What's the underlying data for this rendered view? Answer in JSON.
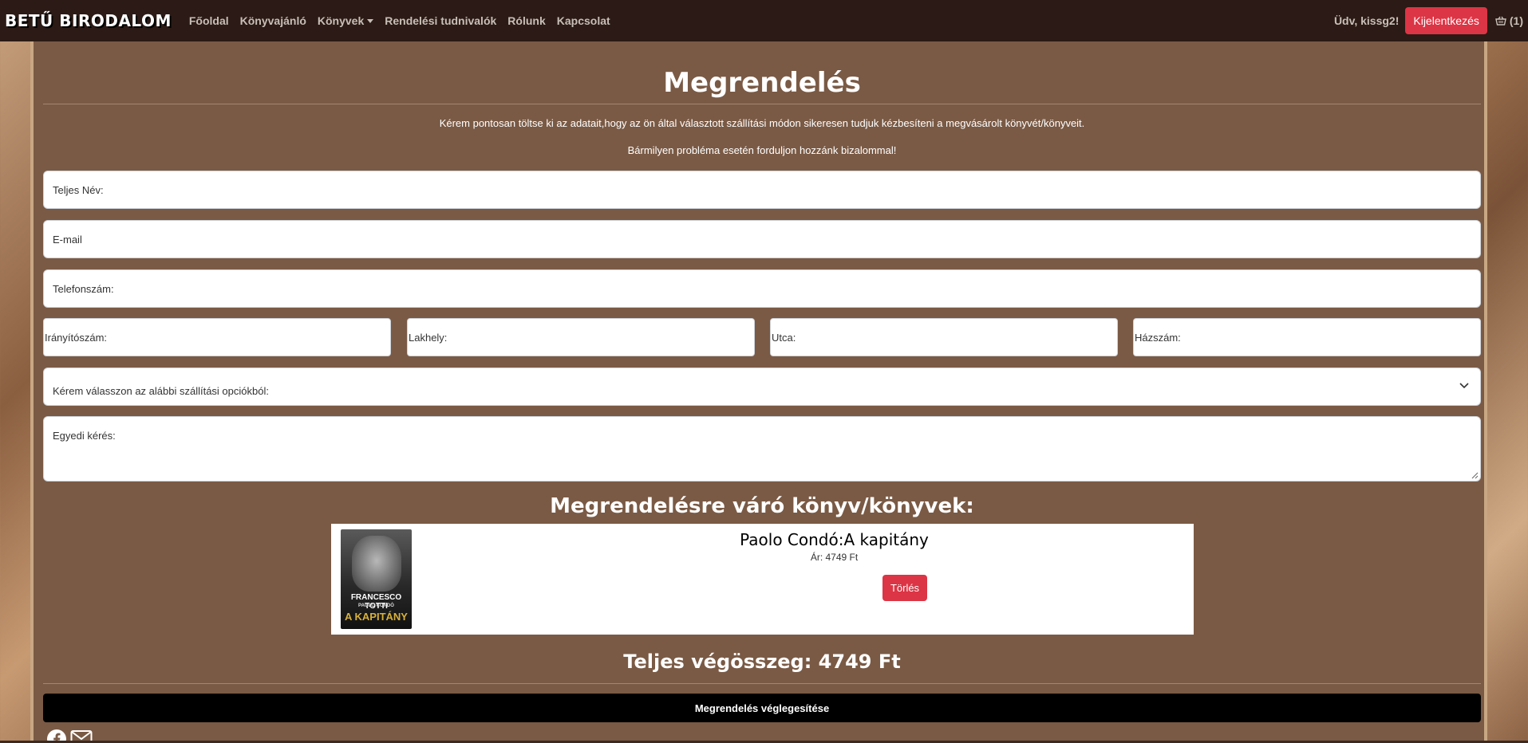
{
  "navbar": {
    "brand": "BETŰ BIRODALOM",
    "links": [
      "Főoldal",
      "Könyvajánló",
      "Könyvek",
      "Rendelési tudnivalók",
      "Rólunk",
      "Kapcsolat"
    ],
    "greeting": "Üdv, kissg2!",
    "logout_label": "Kijelentkezés",
    "cart_count": "(1)"
  },
  "page": {
    "title": "Megrendelés",
    "intro_line1": "Kérem pontosan töltse ki az adatait,hogy az ön által választott szállítási módon sikeresen tudjuk kézbesíteni a megvásárolt könyvét/könyveit.",
    "intro_line2": "Bármilyen probléma esetén forduljon hozzánk bizalommal!"
  },
  "form": {
    "fullname_label": "Teljes Név:",
    "email_label": "E-mail",
    "phone_label": "Telefonszám:",
    "zip_label": "Irányítószám:",
    "city_label": "Lakhely:",
    "street_label": "Utca:",
    "house_label": "Házszám:",
    "shipping_select": "Kérem válasszon az alábbi szállítási opciókból:",
    "request_label": "Egyedi kérés:"
  },
  "order": {
    "heading": "Megrendelésre váró könyv/könyvek:",
    "items": [
      {
        "title": "Paolo Condó:A kapitány",
        "price": "Ár: 4749 Ft",
        "delete_label": "Törlés",
        "cover_author": "FRANCESCO TOTTI",
        "cover_coauthor": "PAOLO CONDÒ",
        "cover_title": "A KAPITÁNY"
      }
    ],
    "total": "Teljes végösszeg: 4749 Ft",
    "finalize_label": "Megrendelés véglegesítése"
  },
  "colors": {
    "navbar": "#2b1a15",
    "panel": "#7a5a45",
    "danger": "#dc3545",
    "finalize": "#000000"
  },
  "icons": [
    "basket-icon",
    "facebook-icon",
    "envelope-icon",
    "chevron-down-icon"
  ]
}
